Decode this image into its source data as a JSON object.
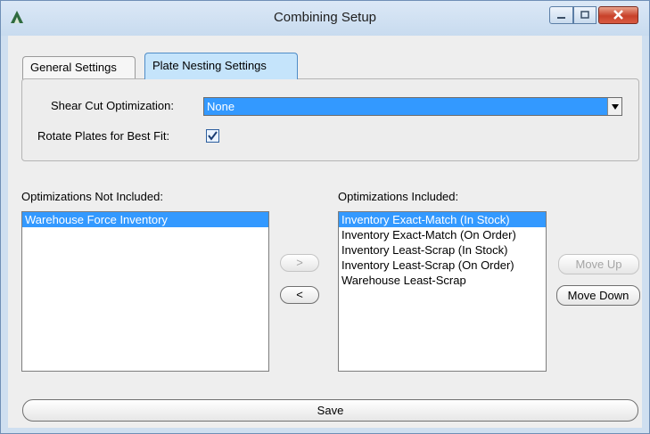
{
  "window": {
    "title": "Combining Setup"
  },
  "tabs": [
    {
      "label": "General Settings",
      "active": false
    },
    {
      "label": "Plate Nesting Settings",
      "active": true
    }
  ],
  "settings": {
    "shear_cut_label": "Shear Cut Optimization:",
    "shear_cut_value": "None",
    "rotate_label": "Rotate Plates for Best Fit:",
    "rotate_checked": true
  },
  "not_included": {
    "label": "Optimizations Not Included:",
    "items": [
      "Warehouse Force Inventory"
    ],
    "selected_index": 0
  },
  "included": {
    "label": "Optimizations Included:",
    "items": [
      "Inventory Exact-Match (In Stock)",
      "Inventory Exact-Match (On Order)",
      "Inventory Least-Scrap (In Stock)",
      "Inventory Least-Scrap (On Order)",
      "Warehouse Least-Scrap"
    ],
    "selected_index": 0
  },
  "buttons": {
    "add": ">",
    "remove": "<",
    "move_up": "Move Up",
    "move_down": "Move Down",
    "save": "Save"
  },
  "colors": {
    "selection": "#3399ff",
    "active_tab": "#c5e4fb",
    "close_button": "#c8412a"
  },
  "icons": [
    "app-logo-icon",
    "minimize-icon",
    "maximize-icon",
    "close-icon",
    "dropdown-arrow-icon",
    "checkmark-icon"
  ]
}
